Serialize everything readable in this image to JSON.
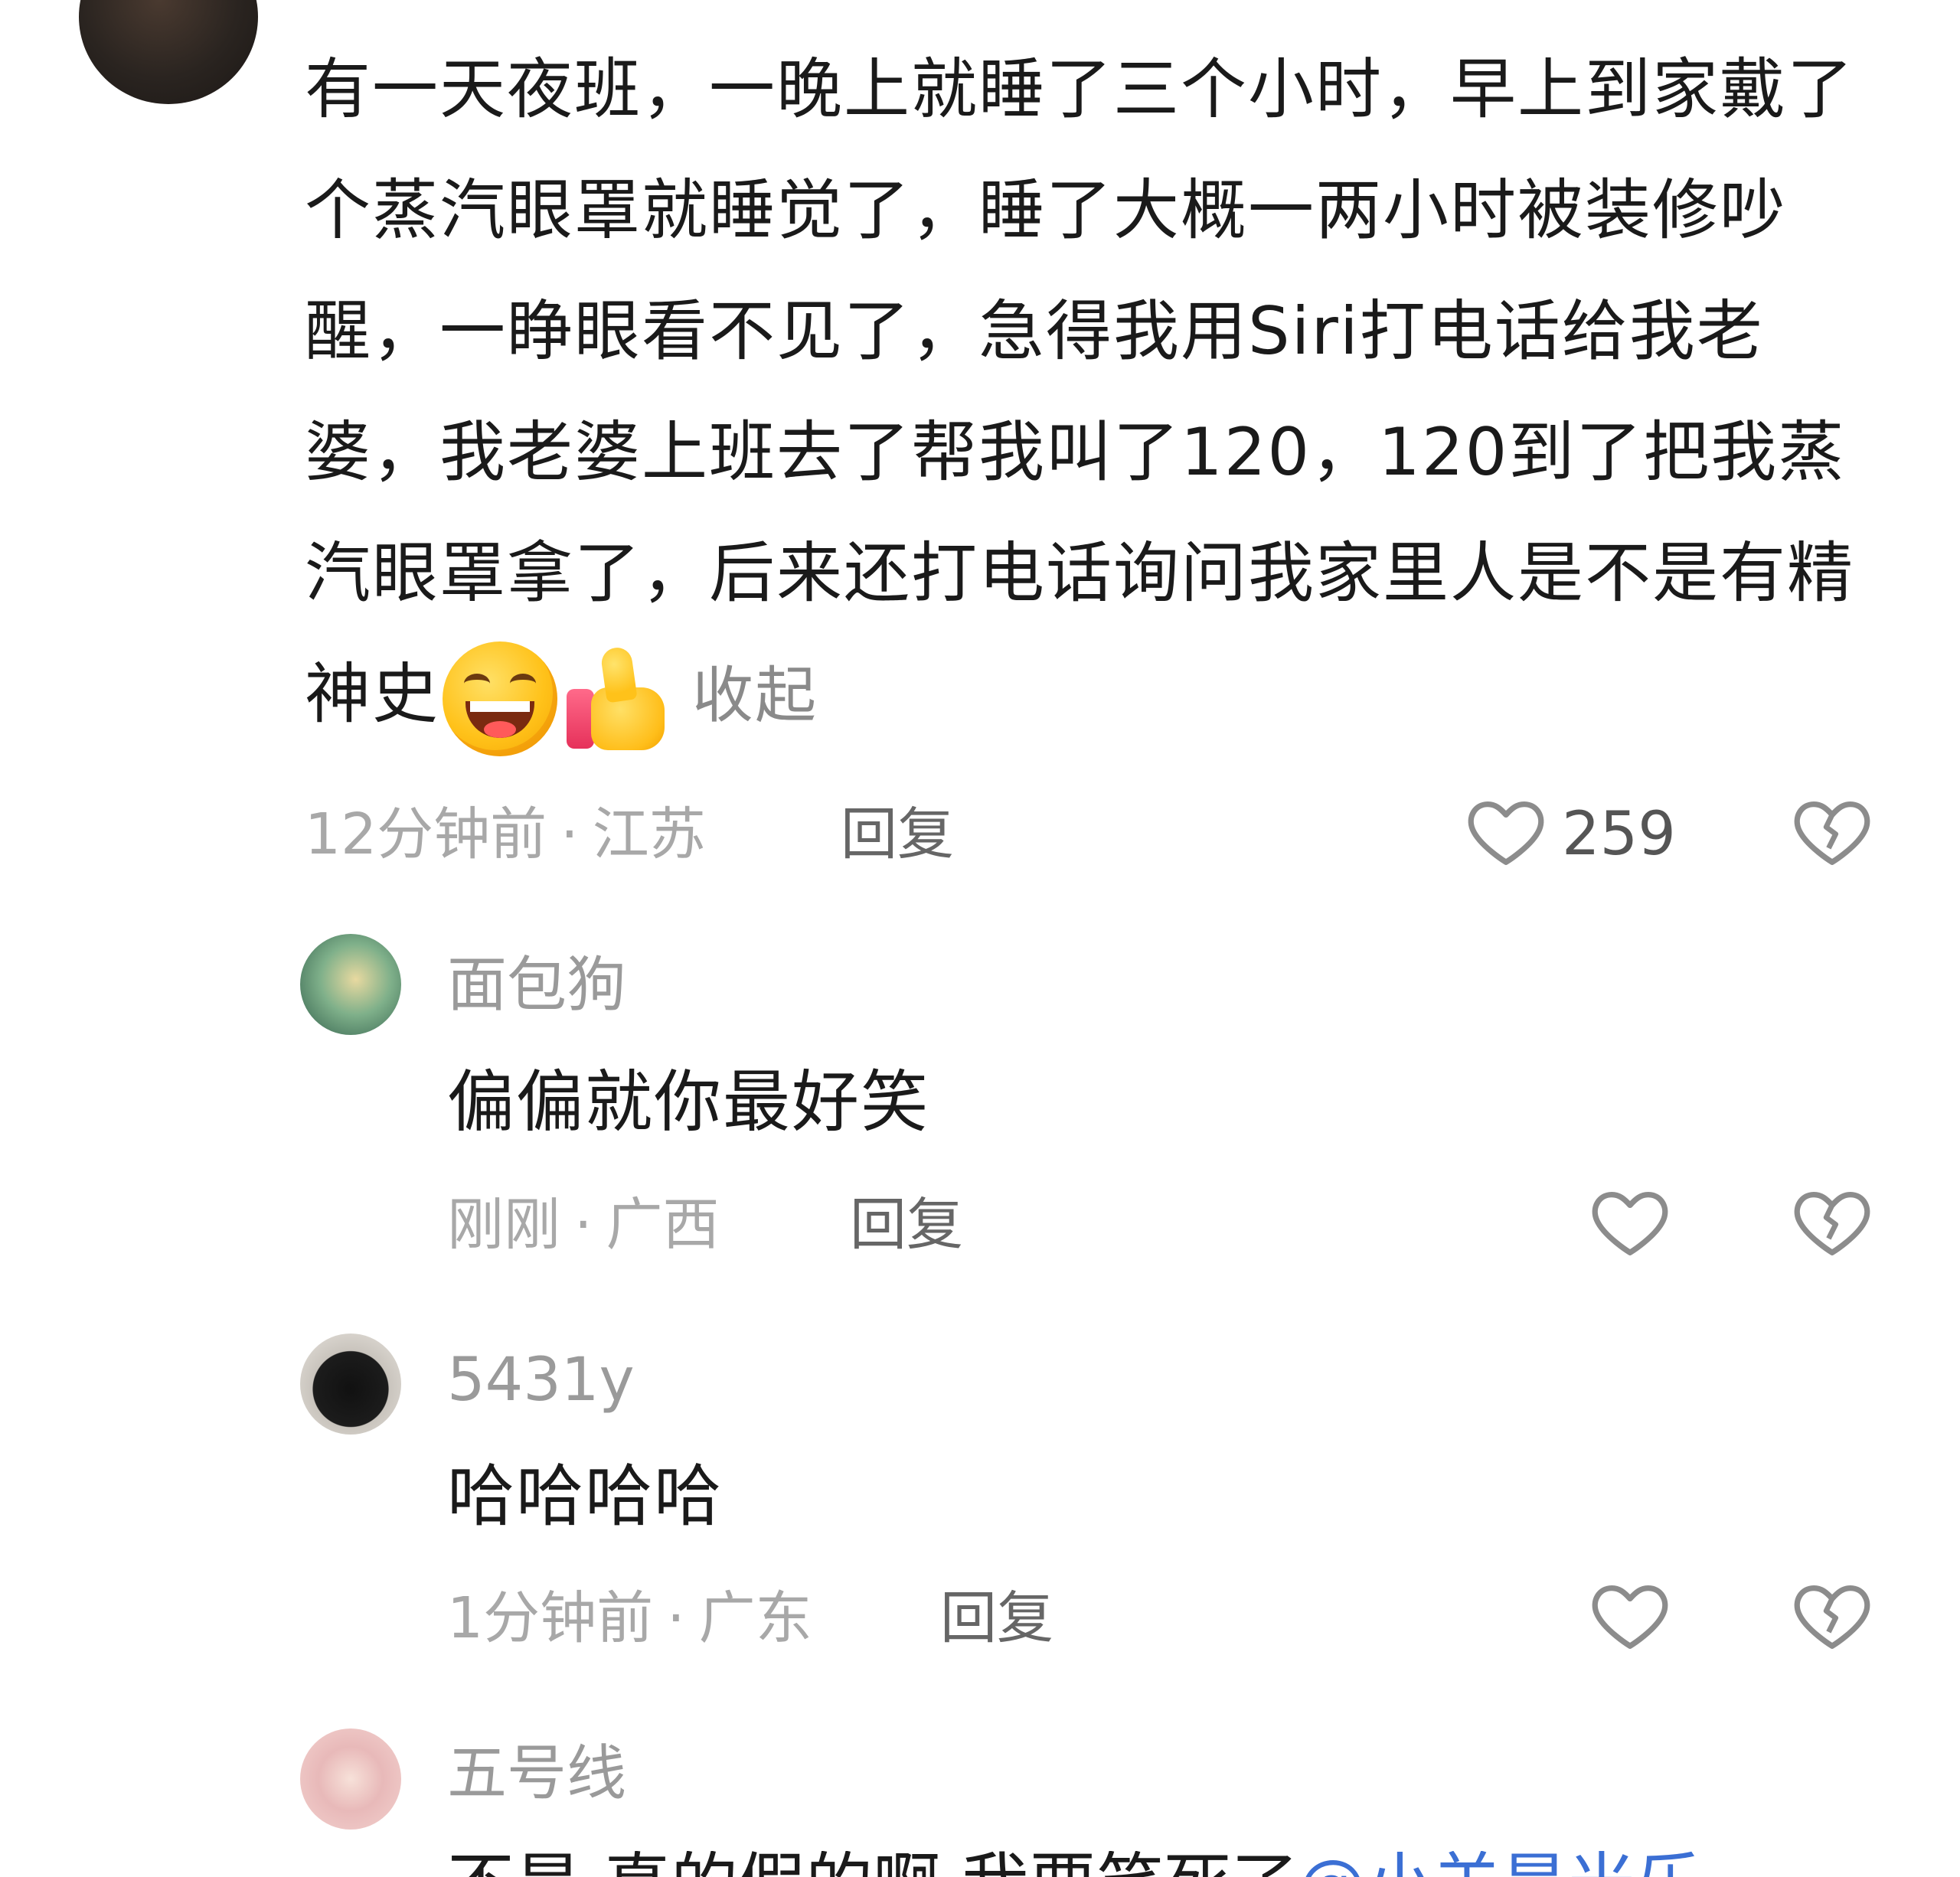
{
  "main_comment": {
    "text": "有一天夜班，一晚上就睡了三个小时，早上到家戴了个蒸汽眼罩就睡觉了，睡了大概一两小时被装修吵醒，一睁眼看不见了，急得我用Siri打电话给我老婆，我老婆上班去了帮我叫了120，120到了把我蒸汽眼罩拿了，后来还打电话询问我家里人是不是有精神史",
    "emojis": [
      "grinning-face",
      "thumbs-up"
    ],
    "collapse_label": "收起",
    "time": "12分钟前",
    "location": "江苏",
    "reply_label": "回复",
    "like_count": "259"
  },
  "replies": [
    {
      "username": "面包狗",
      "text": "偏偏就你最好笑",
      "time": "刚刚",
      "location": "广西",
      "reply_label": "回复"
    },
    {
      "username": "5431y",
      "text": "哈哈哈哈",
      "time": "1分钟前",
      "location": "广东",
      "reply_label": "回复"
    },
    {
      "username": "五号线",
      "text_prefix": "不是 真的假的啊 我要笑死了",
      "mention": "@小羊是米乐"
    }
  ],
  "separator": "·",
  "icons": {
    "like": "heart-outline-icon",
    "dislike": "broken-heart-icon"
  },
  "colors": {
    "meta": "#a8a8a8",
    "mention": "#3b6fd4",
    "icon": "#8c8c8c"
  }
}
